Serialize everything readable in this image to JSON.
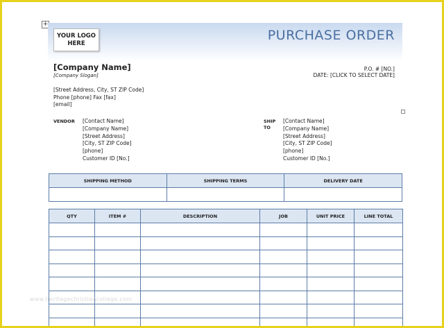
{
  "header": {
    "logo_text": "YOUR LOGO HERE",
    "title": "PURCHASE ORDER",
    "accent_color": "#4a6fa0"
  },
  "company": {
    "name": "[Company Name]",
    "slogan": "[Company Slogan]",
    "address_line1": "[Street Address, City, ST  ZIP Code]",
    "address_line2": "Phone [phone] Fax [fax]",
    "email": "[email]"
  },
  "order": {
    "po_number": "P.O. # [NO.]",
    "date": "DATE: [CLICK TO SELECT DATE]"
  },
  "vendor": {
    "label": "VENDOR",
    "lines": [
      "[Contact Name]",
      "[Company Name]",
      "[Street Address]",
      "[City, ST  ZIP Code]",
      "[phone]",
      "Customer ID [No.]"
    ]
  },
  "ship_to": {
    "label_line1": "SHIP",
    "label_line2": "TO",
    "lines": [
      "[Contact Name]",
      "[Company Name]",
      "[Street Address]",
      "[City, ST  ZIP Code]",
      "[phone]",
      "Customer ID [No.]"
    ]
  },
  "shipping_table": {
    "headers": [
      "SHIPPING METHOD",
      "SHIPPING TERMS",
      "DELIVERY DATE"
    ]
  },
  "items_table": {
    "headers": [
      "QTY",
      "ITEM #",
      "DESCRIPTION",
      "JOB",
      "UNIT PRICE",
      "LINE TOTAL"
    ]
  },
  "watermark": "www.heritagechristiancollege.com"
}
